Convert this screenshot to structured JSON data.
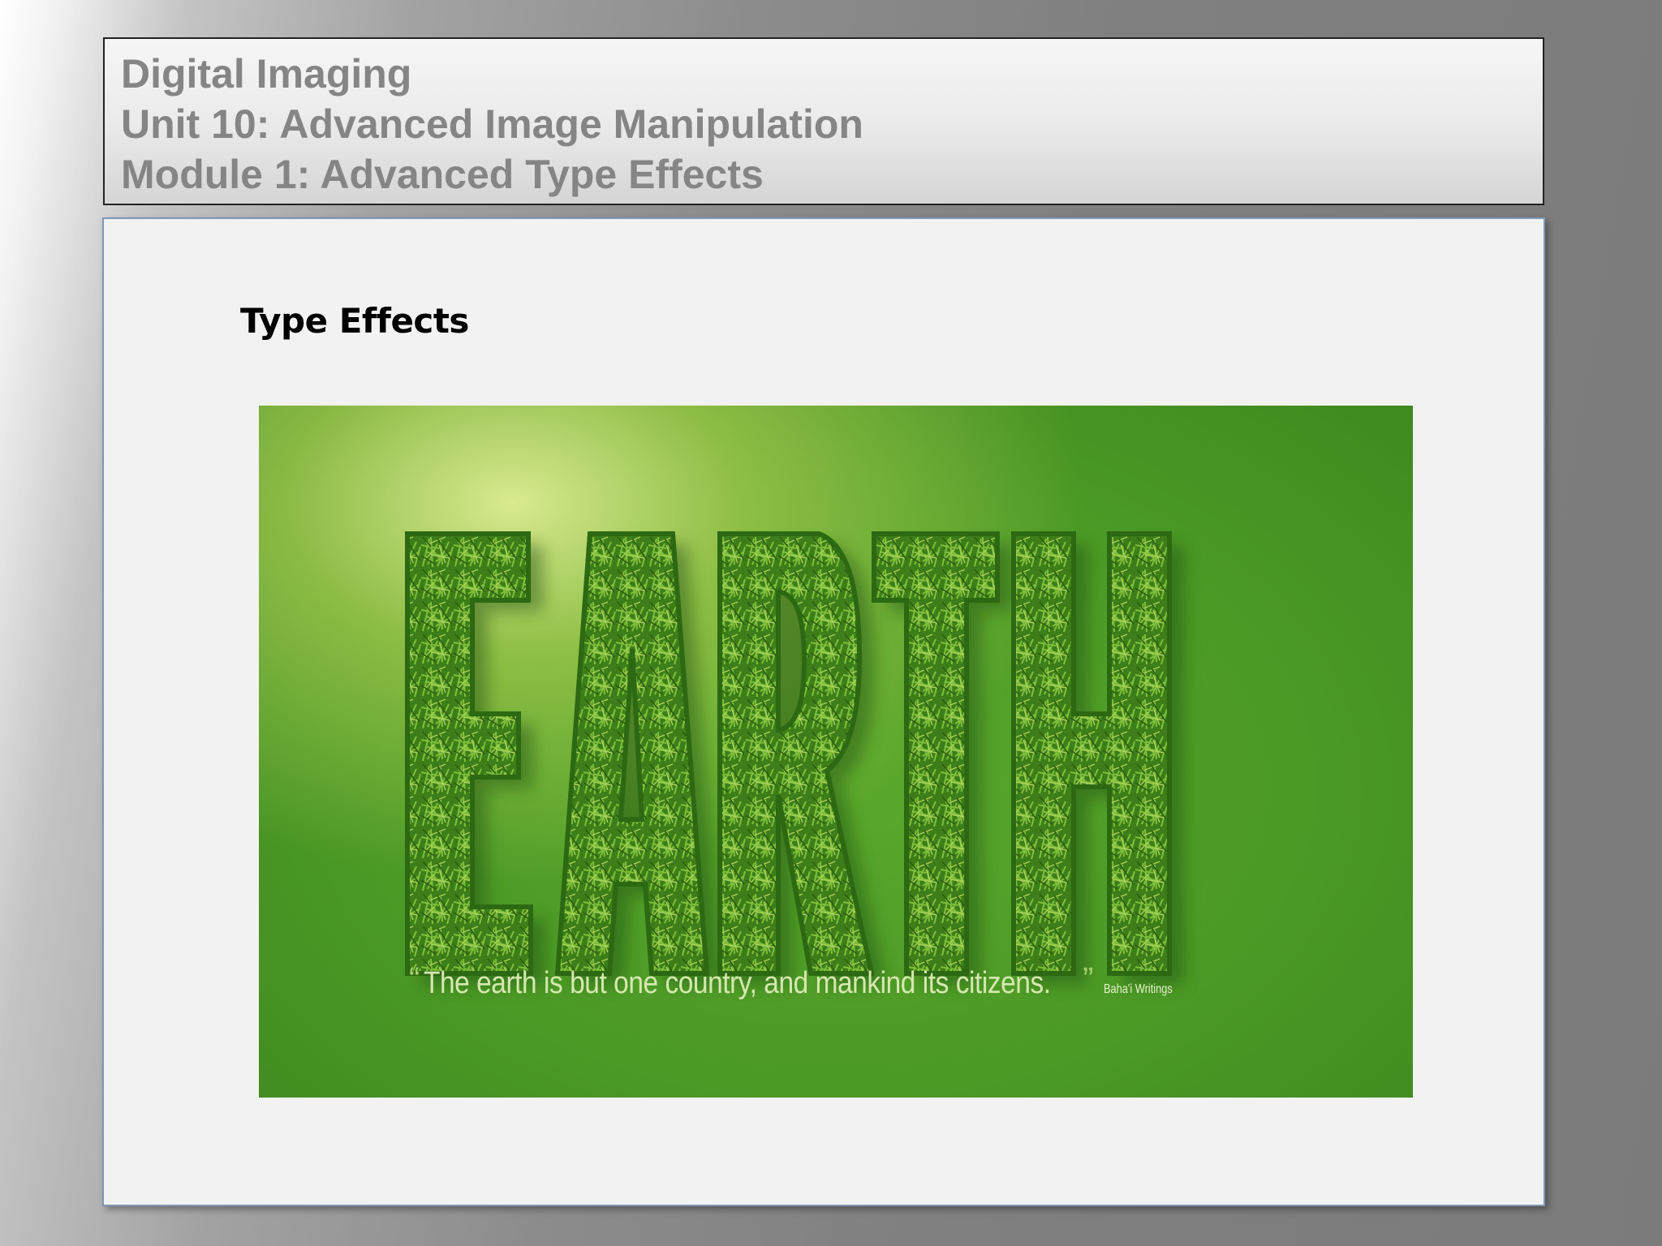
{
  "header": {
    "line1": "Digital Imaging",
    "line2": "Unit 10: Advanced Image Manipulation",
    "line3": "Module 1: Advanced Type Effects"
  },
  "slide": {
    "title": "Type Effects"
  },
  "poster": {
    "word": "EARTH",
    "quote_open": "“",
    "quote": "The earth is but one country, and mankind its citizens.",
    "quote_close": "”",
    "source": "Baha'i Writings",
    "colors": {
      "background": "#4c9a26",
      "grass_letters": "#3f7f1a",
      "quote_text": "#d6e8b0"
    }
  }
}
